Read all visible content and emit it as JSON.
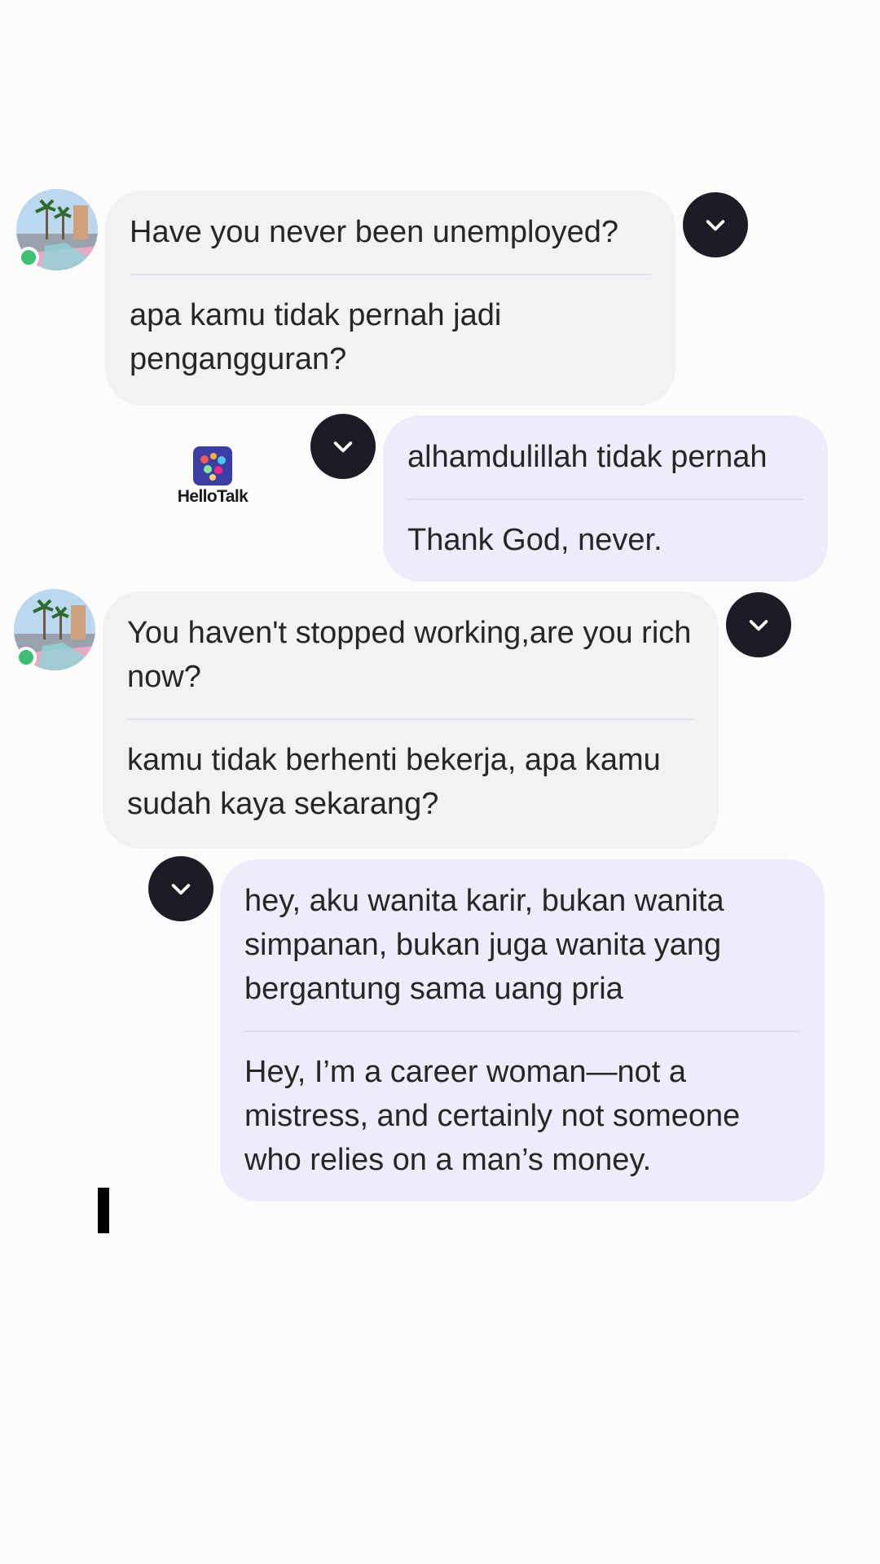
{
  "watermark": {
    "text": "HelloTalk",
    "icon": "hellotalk-logo"
  },
  "messages": [
    {
      "side": "incoming",
      "original": "Have you never been unemployed?",
      "translation": "apa kamu tidak pernah jadi pengangguran?"
    },
    {
      "side": "outgoing",
      "original": "alhamdulillah tidak pernah",
      "translation": "Thank God, never."
    },
    {
      "side": "incoming",
      "original": "You haven't stopped working,are you rich now?",
      "translation": "kamu tidak berhenti bekerja, apa kamu sudah kaya sekarang?"
    },
    {
      "side": "outgoing",
      "original": "hey, aku wanita karir, bukan wanita simpanan, bukan juga wanita yang bergantung sama uang pria",
      "translation": "Hey, I’m a career woman—not a mistress, and certainly not someone who relies on a man’s money."
    }
  ],
  "icons": {
    "menu": "chevron-down-icon",
    "status": "online-status-icon"
  },
  "colors": {
    "incoming_bubble": "#f2f1f3",
    "outgoing_bubble": "#eeebfb",
    "menu_button": "#1d1b24",
    "online": "#3dbe72"
  }
}
